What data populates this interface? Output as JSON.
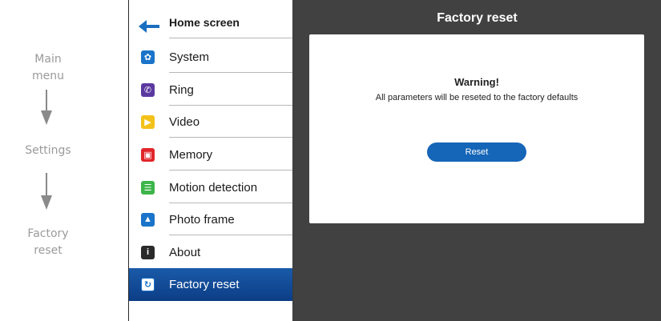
{
  "guide": {
    "steps": [
      "Main\nmenu",
      "Settings",
      "Factory\nreset"
    ]
  },
  "menu": {
    "home_label": "Home screen",
    "items": [
      {
        "label": "System",
        "icon": "gear-icon",
        "color": "#1a74c9"
      },
      {
        "label": "Ring",
        "icon": "phone-icon",
        "color": "#5b3aa0"
      },
      {
        "label": "Video",
        "icon": "play-icon",
        "color": "#f3c21a"
      },
      {
        "label": "Memory",
        "icon": "memory-icon",
        "color": "#e0262a"
      },
      {
        "label": "Motion detection",
        "icon": "motion-icon",
        "color": "#3db54a"
      },
      {
        "label": "Photo frame",
        "icon": "photo-icon",
        "color": "#1a74c9"
      },
      {
        "label": "About",
        "icon": "info-icon",
        "color": "#2a2a2a"
      },
      {
        "label": "Factory reset",
        "icon": "reset-icon",
        "color": "#1a74c9",
        "active": true
      }
    ]
  },
  "content": {
    "title": "Factory reset",
    "warning_title": "Warning!",
    "warning_text": "All parameters will be reseted to the factory defaults",
    "reset_label": "Reset"
  },
  "colors": {
    "accent": "#1565b8",
    "content_bg": "#414141",
    "active_item": "#0c3d86"
  }
}
